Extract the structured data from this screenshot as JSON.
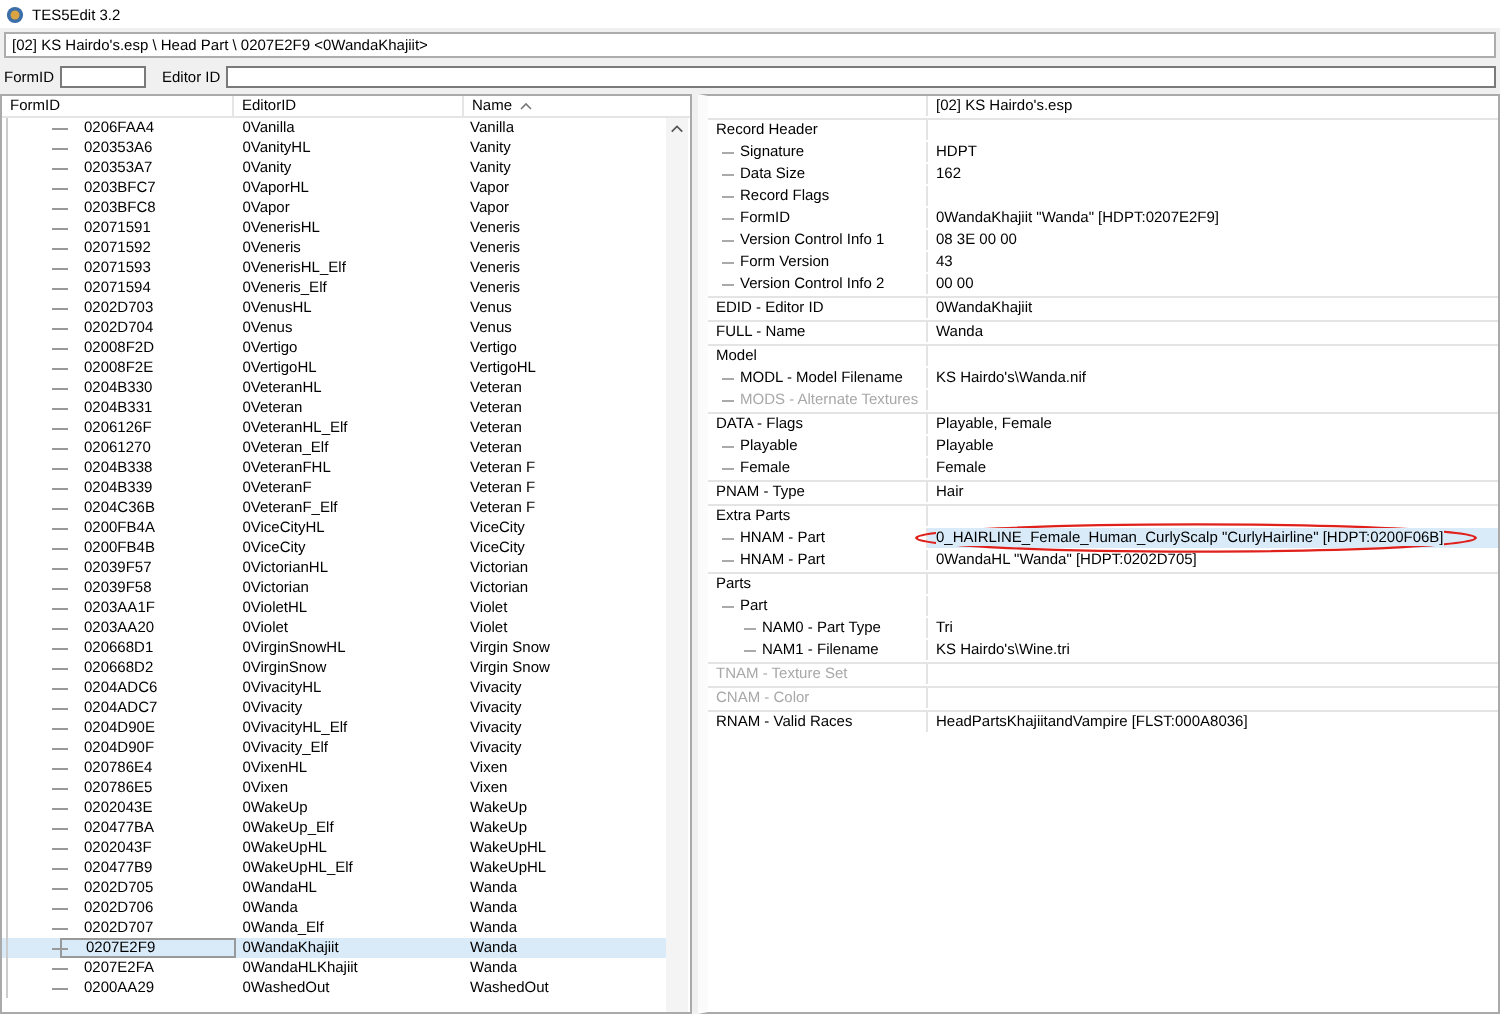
{
  "window": {
    "title": "TES5Edit 3.2"
  },
  "path_bar": {
    "value": "[02] KS Hairdo's.esp \\ Head Part \\ 0207E2F9 <0WandaKhajiit>"
  },
  "filters": [
    {
      "label": "FormID"
    },
    {
      "label": "Editor ID"
    }
  ],
  "record_list": {
    "columns": [
      {
        "label": "FormID",
        "sorted": false
      },
      {
        "label": "EditorID",
        "sorted": false
      },
      {
        "label": "Name",
        "sorted": true
      }
    ],
    "rows": [
      {
        "form_id": "0206FAA4",
        "editor_id": "0Vanilla",
        "name": "Vanilla",
        "selected": false
      },
      {
        "form_id": "020353A6",
        "editor_id": "0VanityHL",
        "name": "Vanity",
        "selected": false
      },
      {
        "form_id": "020353A7",
        "editor_id": "0Vanity",
        "name": "Vanity",
        "selected": false
      },
      {
        "form_id": "0203BFC7",
        "editor_id": "0VaporHL",
        "name": "Vapor",
        "selected": false
      },
      {
        "form_id": "0203BFC8",
        "editor_id": "0Vapor",
        "name": "Vapor",
        "selected": false
      },
      {
        "form_id": "02071591",
        "editor_id": "0VenerisHL",
        "name": "Veneris",
        "selected": false
      },
      {
        "form_id": "02071592",
        "editor_id": "0Veneris",
        "name": "Veneris",
        "selected": false
      },
      {
        "form_id": "02071593",
        "editor_id": "0VenerisHL_Elf",
        "name": "Veneris",
        "selected": false
      },
      {
        "form_id": "02071594",
        "editor_id": "0Veneris_Elf",
        "name": "Veneris",
        "selected": false
      },
      {
        "form_id": "0202D703",
        "editor_id": "0VenusHL",
        "name": "Venus",
        "selected": false
      },
      {
        "form_id": "0202D704",
        "editor_id": "0Venus",
        "name": "Venus",
        "selected": false
      },
      {
        "form_id": "02008F2D",
        "editor_id": "0Vertigo",
        "name": "Vertigo",
        "selected": false
      },
      {
        "form_id": "02008F2E",
        "editor_id": "0VertigoHL",
        "name": "VertigoHL",
        "selected": false
      },
      {
        "form_id": "0204B330",
        "editor_id": "0VeteranHL",
        "name": "Veteran",
        "selected": false
      },
      {
        "form_id": "0204B331",
        "editor_id": "0Veteran",
        "name": "Veteran",
        "selected": false
      },
      {
        "form_id": "0206126F",
        "editor_id": "0VeteranHL_Elf",
        "name": "Veteran",
        "selected": false
      },
      {
        "form_id": "02061270",
        "editor_id": "0Veteran_Elf",
        "name": "Veteran",
        "selected": false
      },
      {
        "form_id": "0204B338",
        "editor_id": "0VeteranFHL",
        "name": "Veteran F",
        "selected": false
      },
      {
        "form_id": "0204B339",
        "editor_id": "0VeteranF",
        "name": "Veteran F",
        "selected": false
      },
      {
        "form_id": "0204C36B",
        "editor_id": "0VeteranF_Elf",
        "name": "Veteran F",
        "selected": false
      },
      {
        "form_id": "0200FB4A",
        "editor_id": "0ViceCityHL",
        "name": "ViceCity",
        "selected": false
      },
      {
        "form_id": "0200FB4B",
        "editor_id": "0ViceCity",
        "name": "ViceCity",
        "selected": false
      },
      {
        "form_id": "02039F57",
        "editor_id": "0VictorianHL",
        "name": "Victorian",
        "selected": false
      },
      {
        "form_id": "02039F58",
        "editor_id": "0Victorian",
        "name": "Victorian",
        "selected": false
      },
      {
        "form_id": "0203AA1F",
        "editor_id": "0VioletHL",
        "name": "Violet",
        "selected": false
      },
      {
        "form_id": "0203AA20",
        "editor_id": "0Violet",
        "name": "Violet",
        "selected": false
      },
      {
        "form_id": "020668D1",
        "editor_id": "0VirginSnowHL",
        "name": "Virgin Snow",
        "selected": false
      },
      {
        "form_id": "020668D2",
        "editor_id": "0VirginSnow",
        "name": "Virgin Snow",
        "selected": false
      },
      {
        "form_id": "0204ADC6",
        "editor_id": "0VivacityHL",
        "name": "Vivacity",
        "selected": false
      },
      {
        "form_id": "0204ADC7",
        "editor_id": "0Vivacity",
        "name": "Vivacity",
        "selected": false
      },
      {
        "form_id": "0204D90E",
        "editor_id": "0VivacityHL_Elf",
        "name": "Vivacity",
        "selected": false
      },
      {
        "form_id": "0204D90F",
        "editor_id": "0Vivacity_Elf",
        "name": "Vivacity",
        "selected": false
      },
      {
        "form_id": "020786E4",
        "editor_id": "0VixenHL",
        "name": "Vixen",
        "selected": false
      },
      {
        "form_id": "020786E5",
        "editor_id": "0Vixen",
        "name": "Vixen",
        "selected": false
      },
      {
        "form_id": "0202043E",
        "editor_id": "0WakeUp",
        "name": "WakeUp",
        "selected": false
      },
      {
        "form_id": "020477BA",
        "editor_id": "0WakeUp_Elf",
        "name": "WakeUp",
        "selected": false
      },
      {
        "form_id": "0202043F",
        "editor_id": "0WakeUpHL",
        "name": "WakeUpHL",
        "selected": false
      },
      {
        "form_id": "020477B9",
        "editor_id": "0WakeUpHL_Elf",
        "name": "WakeUpHL",
        "selected": false
      },
      {
        "form_id": "0202D705",
        "editor_id": "0WandaHL",
        "name": "Wanda",
        "selected": false
      },
      {
        "form_id": "0202D706",
        "editor_id": "0Wanda",
        "name": "Wanda",
        "selected": false
      },
      {
        "form_id": "0202D707",
        "editor_id": "0Wanda_Elf",
        "name": "Wanda",
        "selected": false
      },
      {
        "form_id": "0207E2F9",
        "editor_id": "0WandaKhajiit",
        "name": "Wanda",
        "selected": true
      },
      {
        "form_id": "0207E2FA",
        "editor_id": "0WandaHLKhajiit",
        "name": "Wanda",
        "selected": false
      },
      {
        "form_id": "0200AA29",
        "editor_id": "0WashedOut",
        "name": "WashedOut",
        "selected": false
      }
    ]
  },
  "record_view": {
    "file_header": "[02] KS Hairdo's.esp",
    "fields": [
      {
        "label": "Record Header",
        "disabled": false,
        "selected": false,
        "circled": false,
        "children": [
          {
            "label": "Signature",
            "value": "HDPT",
            "disabled": false,
            "selected": false,
            "circled": false
          },
          {
            "label": "Data Size",
            "value": "162",
            "disabled": false,
            "selected": false,
            "circled": false
          },
          {
            "label": "Record Flags",
            "disabled": false,
            "selected": false,
            "circled": false
          },
          {
            "label": "FormID",
            "value": "0WandaKhajiit \"Wanda\" [HDPT:0207E2F9]",
            "disabled": false,
            "selected": false,
            "circled": false
          },
          {
            "label": "Version Control Info 1",
            "value": "08 3E 00 00",
            "disabled": false,
            "selected": false,
            "circled": false
          },
          {
            "label": "Form Version",
            "value": "43",
            "disabled": false,
            "selected": false,
            "circled": false
          },
          {
            "label": "Version Control Info 2",
            "value": "00 00",
            "disabled": false,
            "selected": false,
            "circled": false
          }
        ]
      },
      {
        "label": "EDID - Editor ID",
        "value": "0WandaKhajiit",
        "disabled": false,
        "selected": false,
        "circled": false
      },
      {
        "label": "FULL - Name",
        "value": "Wanda",
        "disabled": false,
        "selected": false,
        "circled": false
      },
      {
        "label": "Model",
        "disabled": false,
        "selected": false,
        "circled": false,
        "children": [
          {
            "label": "MODL - Model Filename",
            "value": "KS Hairdo's\\Wanda.nif",
            "disabled": false,
            "selected": false,
            "circled": false
          },
          {
            "label": "MODS - Alternate Textures",
            "disabled": true,
            "selected": false,
            "circled": false
          }
        ]
      },
      {
        "label": "DATA - Flags",
        "value": "Playable, Female",
        "disabled": false,
        "selected": false,
        "circled": false,
        "children": [
          {
            "label": "Playable",
            "value": "Playable",
            "disabled": false,
            "selected": false,
            "circled": false
          },
          {
            "label": "Female",
            "value": "Female",
            "disabled": false,
            "selected": false,
            "circled": false
          }
        ]
      },
      {
        "label": "PNAM - Type",
        "value": "Hair",
        "disabled": false,
        "selected": false,
        "circled": false
      },
      {
        "label": "Extra Parts",
        "disabled": false,
        "selected": false,
        "circled": false,
        "children": [
          {
            "label": "HNAM - Part",
            "value": "0_HAIRLINE_Female_Human_CurlyScalp \"CurlyHairline\" [HDPT:0200F06B]",
            "disabled": false,
            "selected": true,
            "circled": true
          },
          {
            "label": "HNAM - Part",
            "value": "0WandaHL \"Wanda\" [HDPT:0202D705]",
            "disabled": false,
            "selected": false,
            "circled": false
          }
        ]
      },
      {
        "label": "Parts",
        "disabled": false,
        "selected": false,
        "circled": false,
        "children": [
          {
            "label": "Part",
            "disabled": false,
            "selected": false,
            "circled": false,
            "children": [
              {
                "label": "NAM0 - Part Type",
                "value": "Tri",
                "disabled": false,
                "selected": false,
                "circled": false
              },
              {
                "label": "NAM1 - Filename",
                "value": "KS Hairdo's\\Wine.tri",
                "disabled": false,
                "selected": false,
                "circled": false
              }
            ]
          }
        ]
      },
      {
        "label": "TNAM - Texture Set",
        "disabled": true,
        "selected": false,
        "circled": false
      },
      {
        "label": "CNAM - Color",
        "disabled": true,
        "selected": false,
        "circled": false
      },
      {
        "label": "RNAM - Valid Races",
        "value": "HeadPartsKhajiitandVampire [FLST:000A8036]",
        "disabled": false,
        "selected": false,
        "circled": false
      }
    ]
  }
}
